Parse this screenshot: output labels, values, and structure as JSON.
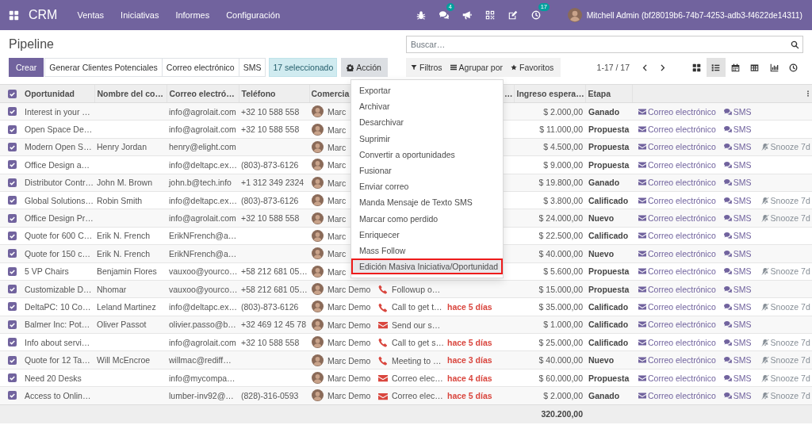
{
  "navbar": {
    "app_name": "CRM",
    "menus": [
      "Ventas",
      "Iniciativas",
      "Informes",
      "Configuración"
    ],
    "messages_badge": "4",
    "activities_badge": "17",
    "user": "Mitchell Admin (bf28019b6-74b7-4253-adb3-f4622de14311)"
  },
  "control_panel": {
    "title": "Pipeline",
    "search": {
      "placeholder": "Buscar…"
    },
    "buttons": [
      {
        "label": "Crear",
        "kind": "primary"
      },
      {
        "label": "Generar Clientes Potenciales",
        "kind": "secondary"
      },
      {
        "label": "Correo electrónico",
        "kind": "secondary"
      },
      {
        "label": "SMS",
        "kind": "secondary"
      }
    ],
    "selection": "17 seleccionado",
    "action_menu": {
      "label": "Acción",
      "expanded": true,
      "items": [
        {
          "label": "Exportar",
          "highlighted": false
        },
        {
          "label": "Archivar",
          "highlighted": false
        },
        {
          "label": "Desarchivar",
          "highlighted": false
        },
        {
          "label": "Suprimir",
          "highlighted": false
        },
        {
          "label": "Convertir a oportunidades",
          "highlighted": false
        },
        {
          "label": "Fusionar",
          "highlighted": false
        },
        {
          "label": "Enviar correo",
          "highlighted": false
        },
        {
          "label": "Manda Mensaje de Texto SMS",
          "highlighted": false
        },
        {
          "label": "Marcar como perdido",
          "highlighted": false
        },
        {
          "label": "Enriquecer",
          "highlighted": false
        },
        {
          "label": "Mass Follow",
          "highlighted": false
        },
        {
          "label": "Edición Masiva Iniciativa/Oportunidad",
          "highlighted": true
        }
      ]
    },
    "search_options": [
      "Filtros",
      "Agrupar por",
      "Favoritos"
    ],
    "pager": "1-17 / 17",
    "views": [
      {
        "kind": "kanban",
        "selected": false
      },
      {
        "kind": "list",
        "selected": true
      },
      {
        "kind": "calendar",
        "selected": false
      },
      {
        "kind": "pivot",
        "selected": false
      },
      {
        "kind": "graph",
        "selected": false
      },
      {
        "kind": "activity",
        "selected": false
      }
    ]
  },
  "table": {
    "all_selected": true,
    "columns": [
      "Oportunidad",
      "Nombre del co…",
      "Correo electró…",
      "Teléfono",
      "Comercia",
      "…",
      "Ingreso espera…",
      "Etapa"
    ],
    "rows": [
      {
        "selected": true,
        "opportunity": "Interest in your …",
        "email": "info@agrolait.com",
        "phone": "+32 10 588 558",
        "salesperson": "Marc",
        "revenue": "$ 2.000,00",
        "stage": "Ganado",
        "buttons": [
          {
            "kind": "email",
            "label": "Correo electrónico"
          },
          {
            "kind": "sms",
            "label": "SMS"
          }
        ]
      },
      {
        "selected": true,
        "opportunity": "Open Space De…",
        "email": "info@agrolait.com",
        "phone": "+32 10 588 558",
        "salesperson": "Marc",
        "revenue": "$ 11.000,00",
        "stage": "Propuesta",
        "buttons": [
          {
            "kind": "email",
            "label": "Correo electrónico"
          },
          {
            "kind": "sms",
            "label": "SMS"
          }
        ]
      },
      {
        "selected": true,
        "opportunity": "Modern Open S…",
        "contact": "Henry Jordan",
        "email": "henry@elight.com",
        "salesperson": "Marc",
        "revenue": "$ 4.500,00",
        "stage": "Propuesta",
        "buttons": [
          {
            "kind": "email",
            "label": "Correo electrónico"
          },
          {
            "kind": "sms",
            "label": "SMS"
          },
          {
            "kind": "snooze",
            "label": "Snooze 7d"
          }
        ]
      },
      {
        "selected": true,
        "opportunity": "Office Design a…",
        "email": "info@deltapc.ex…",
        "phone": "(803)-873-6126",
        "salesperson": "Marc",
        "revenue": "$ 9.000,00",
        "stage": "Propuesta",
        "buttons": [
          {
            "kind": "email",
            "label": "Correo electrónico"
          },
          {
            "kind": "sms",
            "label": "SMS"
          }
        ]
      },
      {
        "selected": true,
        "opportunity": "Distributor Contr…",
        "contact": "John M. Brown",
        "email": "john.b@tech.info",
        "phone": "+1 312 349 2324",
        "salesperson": "Marc",
        "revenue": "$ 19.800,00",
        "stage": "Ganado",
        "buttons": [
          {
            "kind": "email",
            "label": "Correo electrónico"
          },
          {
            "kind": "sms",
            "label": "SMS"
          }
        ]
      },
      {
        "selected": true,
        "opportunity": "Global Solutions…",
        "contact": "Robin Smith",
        "email": "info@deltapc.ex…",
        "phone": "(803)-873-6126",
        "salesperson": "Marc",
        "revenue": "$ 3.800,00",
        "stage": "Calificado",
        "buttons": [
          {
            "kind": "email",
            "label": "Correo electrónico"
          },
          {
            "kind": "sms",
            "label": "SMS"
          },
          {
            "kind": "snooze",
            "label": "Snooze 7d"
          }
        ]
      },
      {
        "selected": true,
        "opportunity": "Office Design Pr…",
        "email": "info@agrolait.com",
        "phone": "+32 10 588 558",
        "salesperson": "Marc",
        "revenue": "$ 24.000,00",
        "stage": "Nuevo",
        "buttons": [
          {
            "kind": "email",
            "label": "Correo electrónico"
          },
          {
            "kind": "sms",
            "label": "SMS"
          },
          {
            "kind": "snooze",
            "label": "Snooze 7d"
          }
        ]
      },
      {
        "selected": true,
        "opportunity": "Quote for 600 C…",
        "contact": "Erik N. French",
        "email": "ErikNFrench@a…",
        "salesperson": "Marc",
        "revenue": "$ 22.500,00",
        "stage": "Calificado",
        "buttons": [
          {
            "kind": "email",
            "label": "Correo electrónico"
          },
          {
            "kind": "sms",
            "label": "SMS"
          }
        ]
      },
      {
        "selected": true,
        "opportunity": "Quote for 150 c…",
        "contact": "Erik N. French",
        "email": "ErikNFrench@a…",
        "salesperson": "Marc",
        "revenue": "$ 40.000,00",
        "stage": "Nuevo",
        "buttons": [
          {
            "kind": "email",
            "label": "Correo electrónico"
          },
          {
            "kind": "sms",
            "label": "SMS"
          }
        ]
      },
      {
        "selected": true,
        "opportunity": "5 VP Chairs",
        "contact": "Benjamin Flores",
        "email": "vauxoo@yourco…",
        "phone": "+58 212 681 05…",
        "salesperson": "Marc",
        "revenue": "$ 5.600,00",
        "stage": "Propuesta",
        "buttons": [
          {
            "kind": "email",
            "label": "Correo electrónico"
          },
          {
            "kind": "sms",
            "label": "SMS"
          },
          {
            "kind": "snooze",
            "label": "Snooze 7d"
          }
        ]
      },
      {
        "selected": true,
        "opportunity": "Customizable D…",
        "contact": "Nhomar",
        "email": "vauxoo@yourco…",
        "phone": "+58 212 681 05…",
        "salesperson": "Marc Demo",
        "activity": {
          "kind": "call",
          "summary": "Followup o…"
        },
        "revenue": "$ 15.000,00",
        "stage": "Propuesta",
        "buttons": [
          {
            "kind": "email",
            "label": "Correo electrónico"
          },
          {
            "kind": "sms",
            "label": "SMS"
          }
        ]
      },
      {
        "selected": true,
        "opportunity": "DeltaPC: 10 Co…",
        "contact": "Leland Martinez",
        "email": "info@deltapc.ex…",
        "phone": "(803)-873-6126",
        "salesperson": "Marc Demo",
        "activity": {
          "kind": "call",
          "summary": "Call to get t…"
        },
        "deadline": "hace 5 días",
        "revenue": "$ 35.000,00",
        "stage": "Calificado",
        "buttons": [
          {
            "kind": "email",
            "label": "Correo electrónico"
          },
          {
            "kind": "sms",
            "label": "SMS"
          },
          {
            "kind": "snooze",
            "label": "Snooze 7d"
          }
        ]
      },
      {
        "selected": true,
        "opportunity": "Balmer Inc: Pot…",
        "contact": "Oliver Passot",
        "email": "olivier.passo@b…",
        "phone": "+32 469 12 45 78",
        "salesperson": "Marc Demo",
        "activity": {
          "kind": "email",
          "summary": "Send our s…"
        },
        "revenue": "$ 1.000,00",
        "stage": "Calificado",
        "buttons": [
          {
            "kind": "email",
            "label": "Correo electrónico"
          },
          {
            "kind": "sms",
            "label": "SMS"
          }
        ]
      },
      {
        "selected": true,
        "opportunity": "Info about servi…",
        "email": "info@agrolait.com",
        "phone": "+32 10 588 558",
        "salesperson": "Marc Demo",
        "activity": {
          "kind": "call",
          "summary": "Call to get s…"
        },
        "deadline": "hace 5 días",
        "revenue": "$ 25.000,00",
        "stage": "Calificado",
        "buttons": [
          {
            "kind": "email",
            "label": "Correo electrónico"
          },
          {
            "kind": "sms",
            "label": "SMS"
          },
          {
            "kind": "snooze",
            "label": "Snooze 7d"
          }
        ]
      },
      {
        "selected": true,
        "opportunity": "Quote for 12 Ta…",
        "contact": "Will McEncroe",
        "email": "willmac@rediff…",
        "salesperson": "Marc Demo",
        "activity": {
          "kind": "call",
          "summary": "Meeting to …"
        },
        "deadline": "hace 3 días",
        "revenue": "$ 40.000,00",
        "stage": "Nuevo",
        "buttons": [
          {
            "kind": "email",
            "label": "Correo electrónico"
          },
          {
            "kind": "sms",
            "label": "SMS"
          },
          {
            "kind": "snooze",
            "label": "Snooze 7d"
          }
        ]
      },
      {
        "selected": true,
        "opportunity": "Need 20 Desks",
        "email": "info@mycompa…",
        "salesperson": "Marc Demo",
        "activity": {
          "kind": "email",
          "summary": "Correo elec…"
        },
        "deadline": "hace 4 días",
        "revenue": "$ 60.000,00",
        "stage": "Propuesta",
        "buttons": [
          {
            "kind": "email",
            "label": "Correo electrónico"
          },
          {
            "kind": "sms",
            "label": "SMS"
          },
          {
            "kind": "snooze",
            "label": "Snooze 7d"
          }
        ]
      },
      {
        "selected": true,
        "opportunity": "Access to Onlin…",
        "email": "lumber-inv92@…",
        "phone": "(828)-316-0593",
        "salesperson": "Marc Demo",
        "activity": {
          "kind": "email",
          "summary": "Correo elec…"
        },
        "deadline": "hace 5 días",
        "revenue": "$ 2.000,00",
        "stage": "Ganado",
        "buttons": [
          {
            "kind": "email",
            "label": "Correo electrónico"
          },
          {
            "kind": "sms",
            "label": "SMS"
          },
          {
            "kind": "snooze",
            "label": "Snooze 7d"
          }
        ]
      }
    ],
    "total_revenue": "320.200,00"
  }
}
